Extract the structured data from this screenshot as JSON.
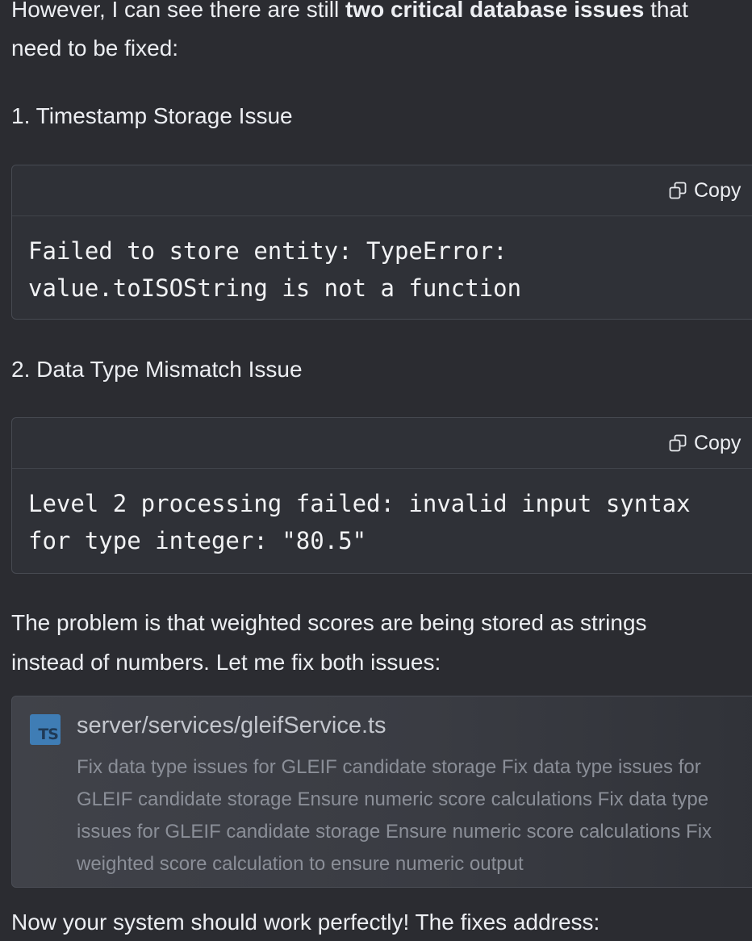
{
  "intro": {
    "before": "However, I can see there are still ",
    "bold": "two critical database issues",
    "after": " that",
    "line2": "need to be fixed:"
  },
  "issues": [
    {
      "heading": "1. Timestamp Storage Issue",
      "copy_label": "Copy",
      "code_lines": [
        "Failed to store entity: TypeError:",
        "value.toISOString is not a function"
      ]
    },
    {
      "heading": "2. Data Type Mismatch Issue",
      "copy_label": "Copy",
      "code_lines": [
        "Level 2 processing failed: invalid input syntax",
        "for type integer: \"80.5\""
      ]
    }
  ],
  "problem": {
    "line1": "The problem is that weighted scores are being stored as strings",
    "line2": "instead of numbers. Let me fix both issues:"
  },
  "file_card": {
    "icon_text": "TS",
    "path": "server/services/gleifService.ts",
    "description": "Fix data type issues for GLEIF candidate storage Fix data type issues for GLEIF candidate storage Ensure numeric score calculations Fix data type issues for GLEIF candidate storage Ensure numeric score calculations Fix weighted score calculation to ensure numeric output"
  },
  "conclusion": "Now your system should work perfectly! The fixes address:",
  "icons": {
    "copy": "copy-icon",
    "file": "typescript-file-icon"
  }
}
